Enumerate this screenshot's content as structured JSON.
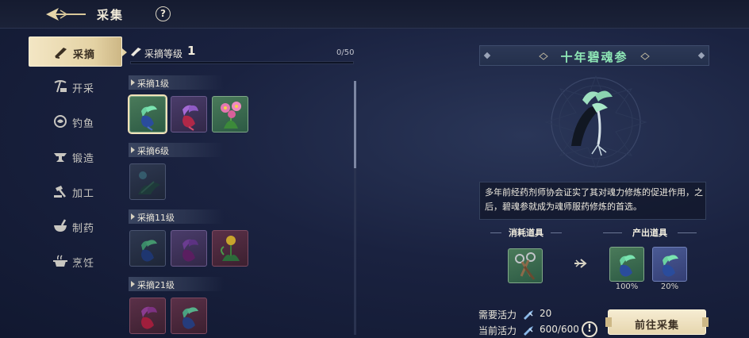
{
  "header": {
    "title": "采集",
    "help": "?"
  },
  "sidebar": {
    "items": [
      {
        "label": "采摘",
        "icon": "pick-icon",
        "active": true
      },
      {
        "label": "开采",
        "icon": "mining-icon",
        "active": false
      },
      {
        "label": "钓鱼",
        "icon": "fishing-icon",
        "active": false
      },
      {
        "label": "锻造",
        "icon": "anvil-icon",
        "active": false
      },
      {
        "label": "加工",
        "icon": "hammer-icon",
        "active": false
      },
      {
        "label": "制药",
        "icon": "mortar-icon",
        "active": false
      },
      {
        "label": "烹饪",
        "icon": "cooking-icon",
        "active": false
      }
    ]
  },
  "level": {
    "label": "采摘等级",
    "value": "1",
    "progress_text": "0/50",
    "progress_fraction": 0
  },
  "tiers": [
    {
      "label": "采摘1级"
    },
    {
      "label": "采摘6级"
    },
    {
      "label": "采摘11级"
    },
    {
      "label": "采摘21级"
    }
  ],
  "detail": {
    "title": "十年碧魂参",
    "description": "多年前经药剂师协会证实了其对魂力修炼的促进作用，之后，碧魂参就成为魂师服药修炼的首选。",
    "consume_label": "消耗道具",
    "output_label": "产出道具",
    "outputs": [
      {
        "pct": "100%"
      },
      {
        "pct": "20%"
      }
    ],
    "need_vitality_label": "需要活力",
    "need_vitality_value": "20",
    "current_vitality_label": "当前活力",
    "current_vitality_value": "600/600",
    "warn": "!",
    "go_button": "前往采集"
  },
  "colors": {
    "accent_gold": "#e4d2a4",
    "title_green": "#8fe8b6",
    "background": "#1a2240"
  }
}
